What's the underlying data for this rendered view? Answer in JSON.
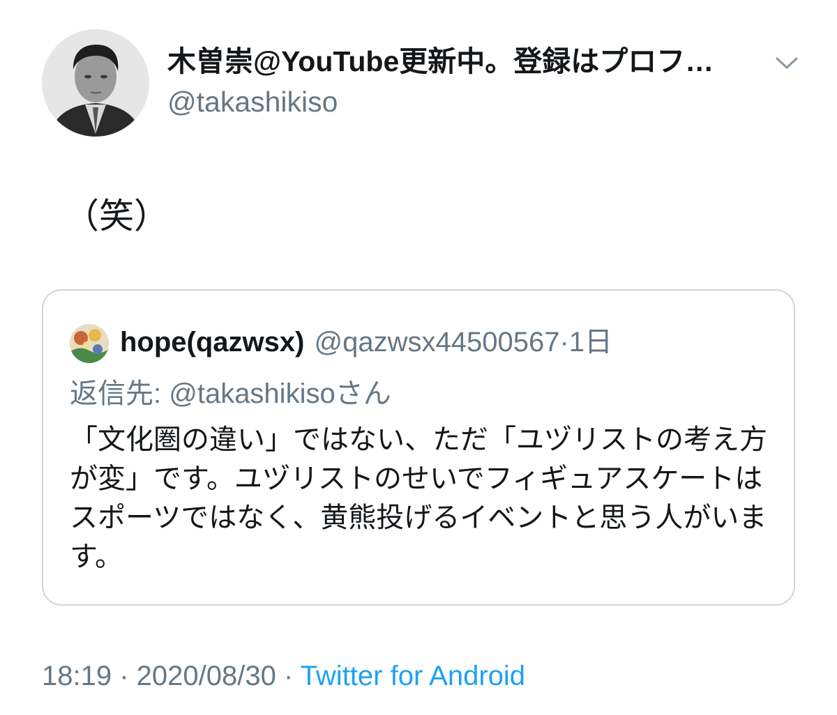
{
  "author": {
    "display_name": "木曽崇@YouTube更新中。登録はプロフ…",
    "handle": "@takashikiso",
    "avatar_icon": "user-photo-avatar",
    "menu_icon": "chevron-down-icon"
  },
  "tweet": {
    "text": "（笑）"
  },
  "quoted_tweet": {
    "name": "hope(qazwsx)",
    "handle": "@qazwsx44500567",
    "separator": "·",
    "time": "1日",
    "reply_to": "返信先: @takashikisoさん",
    "text": "「文化圏の違い」ではない、ただ「ユヅリストの考え方が変」です。ユヅリストのせいでフィギュアスケートはスポーツではなく、黄熊投げるイベントと思う人がいます。"
  },
  "meta": {
    "time": "18:19",
    "separator": " · ",
    "date": "2020/08/30",
    "source": "Twitter for Android"
  },
  "colors": {
    "text_primary": "#14171a",
    "text_secondary": "#657786",
    "link": "#1da1f2",
    "border": "#ccd6dd"
  }
}
